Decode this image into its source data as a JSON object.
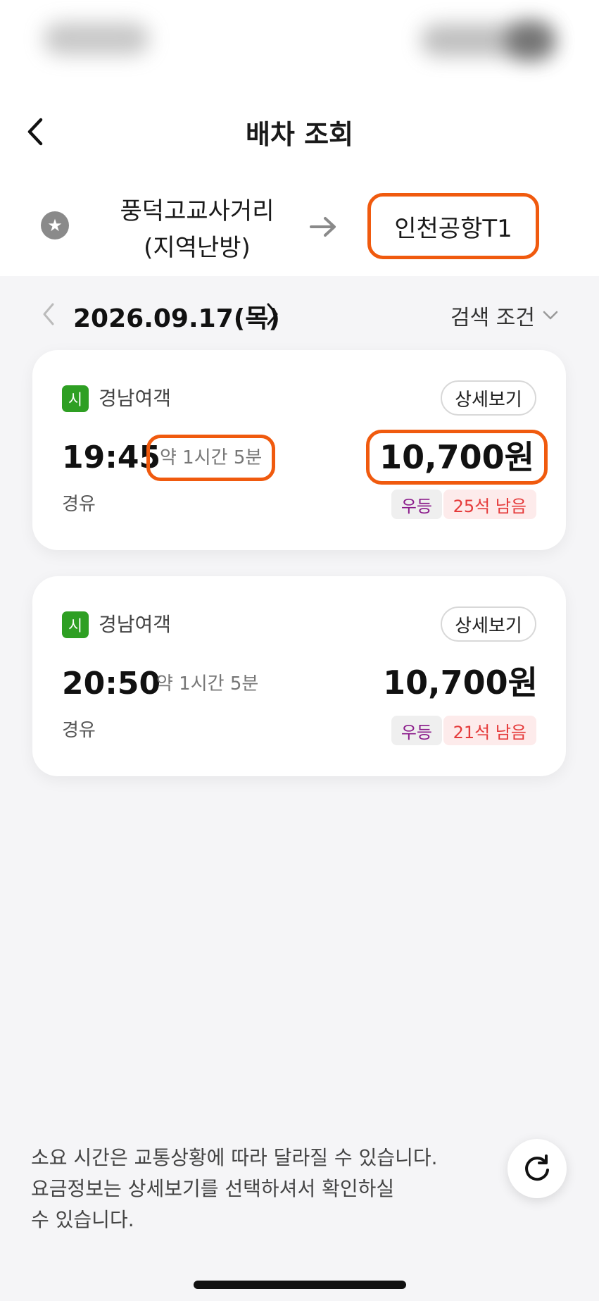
{
  "header": {
    "title": "배차 조회",
    "back_icon": "chevron-left-icon"
  },
  "route": {
    "origin_line1": "풍덕고교사거리",
    "origin_line2": "(지역난방)",
    "destination": "인천공항T1",
    "favorite_icon": "star-icon",
    "arrow_icon": "arrow-right-icon"
  },
  "date_bar": {
    "date": "2026.09.17(목)",
    "filter_label": "검색 조건"
  },
  "results": [
    {
      "badge": "시",
      "company": "경남여객",
      "detail_label": "상세보기",
      "departure": "19:45",
      "duration": "약 1시간 5분",
      "price": "10,700원",
      "via": "경유",
      "seat_class": "우등",
      "seats_left": "25석 남음"
    },
    {
      "badge": "시",
      "company": "경남여객",
      "detail_label": "상세보기",
      "departure": "20:50",
      "duration": "약 1시간 5분",
      "price": "10,700원",
      "via": "경유",
      "seat_class": "우등",
      "seats_left": "21석 남음"
    }
  ],
  "footer": {
    "notice_line1": "소요 시간은 교통상황에 따라 달라질 수 있습니다.",
    "notice_line2": "요금정보는 상세보기를 선택하셔서 확인하실",
    "notice_line3": "수 있습니다.",
    "refresh_icon": "refresh-icon"
  },
  "colors": {
    "highlight": "#f05a0e",
    "badge_green": "#2e9f23",
    "seat_class_text": "#8a1a8a",
    "seats_left_text": "#e53a3a"
  }
}
